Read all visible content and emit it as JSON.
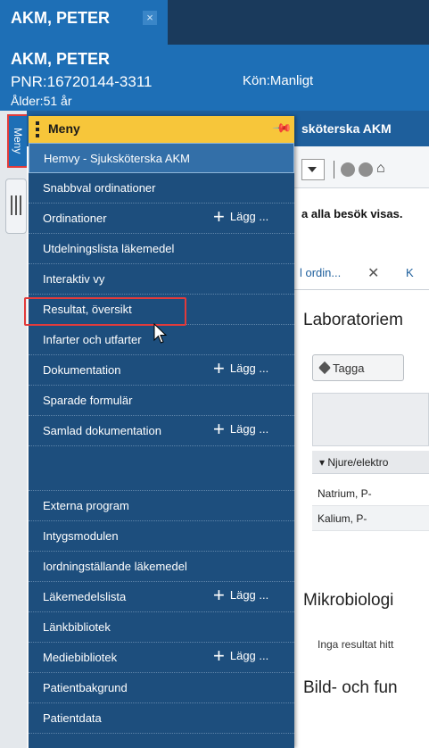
{
  "patient_tab": {
    "title": "AKM, PETER",
    "close": "×"
  },
  "patient_header": {
    "name": "AKM, PETER",
    "pnr": "PNR:16720144-3311",
    "kon": "Kön:Manligt",
    "alder": "Ålder:51 år"
  },
  "left_strip": {
    "menu_label": "Meny"
  },
  "menu": {
    "title": "Meny",
    "items": [
      {
        "label": "Hemvy - Sjuksköterska AKM",
        "add": "",
        "selected": true
      },
      {
        "label": "Snabbval ordinationer",
        "add": ""
      },
      {
        "label": "Ordinationer",
        "add": "Lägg ..."
      },
      {
        "label": "Utdelningslista läkemedel",
        "add": ""
      },
      {
        "label": "Interaktiv vy",
        "add": ""
      },
      {
        "label": "Resultat, översikt",
        "add": ""
      },
      {
        "label": "Infarter och utfarter",
        "add": ""
      },
      {
        "label": "Dokumentation",
        "add": "Lägg ..."
      },
      {
        "label": "Sparade formulär",
        "add": ""
      },
      {
        "label": "Samlad dokumentation",
        "add": "Lägg ..."
      },
      {
        "label": "",
        "add": ""
      },
      {
        "label": "Externa program",
        "add": ""
      },
      {
        "label": "Intygsmodulen",
        "add": ""
      },
      {
        "label": "Iordningställande läkemedel",
        "add": ""
      },
      {
        "label": "Läkemedelslista",
        "add": "Lägg ..."
      },
      {
        "label": "Länkbibliotek",
        "add": ""
      },
      {
        "label": "Mediebibliotek",
        "add": "Lägg ..."
      },
      {
        "label": "Patientbakgrund",
        "add": ""
      },
      {
        "label": "Patientdata",
        "add": ""
      }
    ]
  },
  "background": {
    "title_fragment": "sköterska AKM",
    "notice": "a alla besök visas.",
    "tab_label": "l ordin...",
    "tab_close": "✕",
    "tab_next": "K",
    "lab_title": "Laboratoriem",
    "tagga": "Tagga",
    "group_row": "▾ Njure/elektro",
    "rows": [
      "Natrium, P-",
      "Kalium, P-"
    ],
    "mikro_title": "Mikrobiologi",
    "inga": "Inga resultat hitt",
    "bild_title": "Bild- och fun"
  },
  "colors": {
    "menu_bg": "#1d4e7d",
    "menu_header": "#f7c63a",
    "header_blue": "#1e6fb6",
    "highlight": "#e23b3b"
  }
}
